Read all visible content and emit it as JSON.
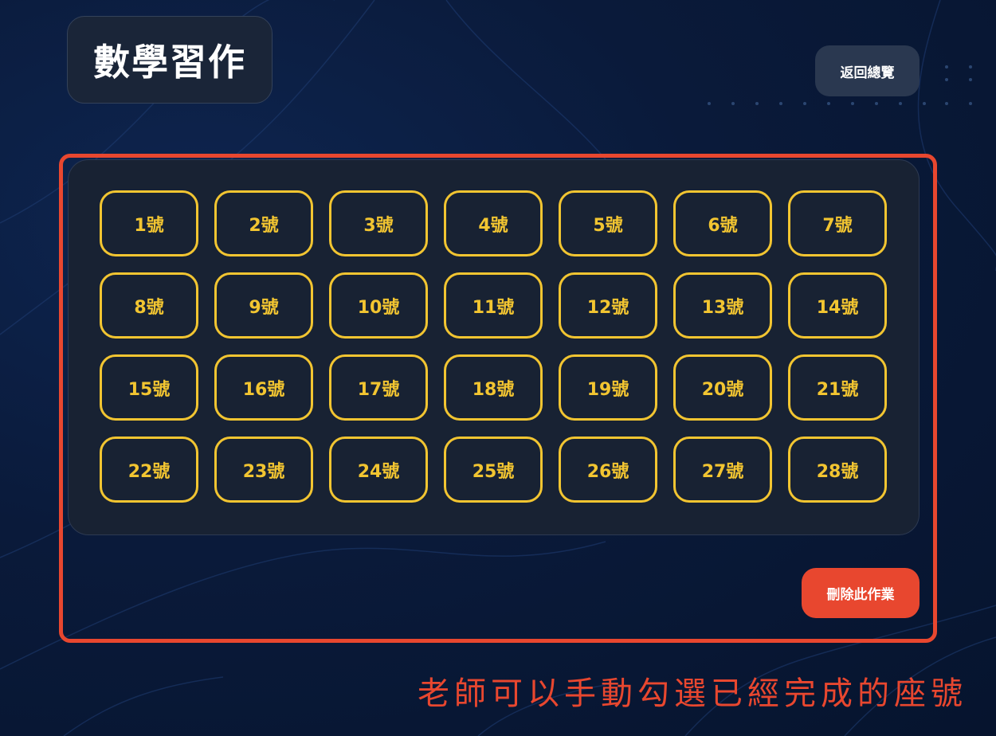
{
  "header": {
    "title": "數學習作",
    "back_label": "返回總覽"
  },
  "seats": [
    "1號",
    "2號",
    "3號",
    "4號",
    "5號",
    "6號",
    "7號",
    "8號",
    "9號",
    "10號",
    "11號",
    "12號",
    "13號",
    "14號",
    "15號",
    "16號",
    "17號",
    "18號",
    "19號",
    "20號",
    "21號",
    "22號",
    "23號",
    "24號",
    "25號",
    "26號",
    "27號",
    "28號"
  ],
  "actions": {
    "delete_label": "刪除此作業"
  },
  "annotation": {
    "caption": "老師可以手動勾選已經完成的座號"
  },
  "colors": {
    "accent_yellow": "#f2c531",
    "danger_red": "#e8472f",
    "panel_bg": "#182233",
    "page_bg": "#0a1a3a"
  }
}
